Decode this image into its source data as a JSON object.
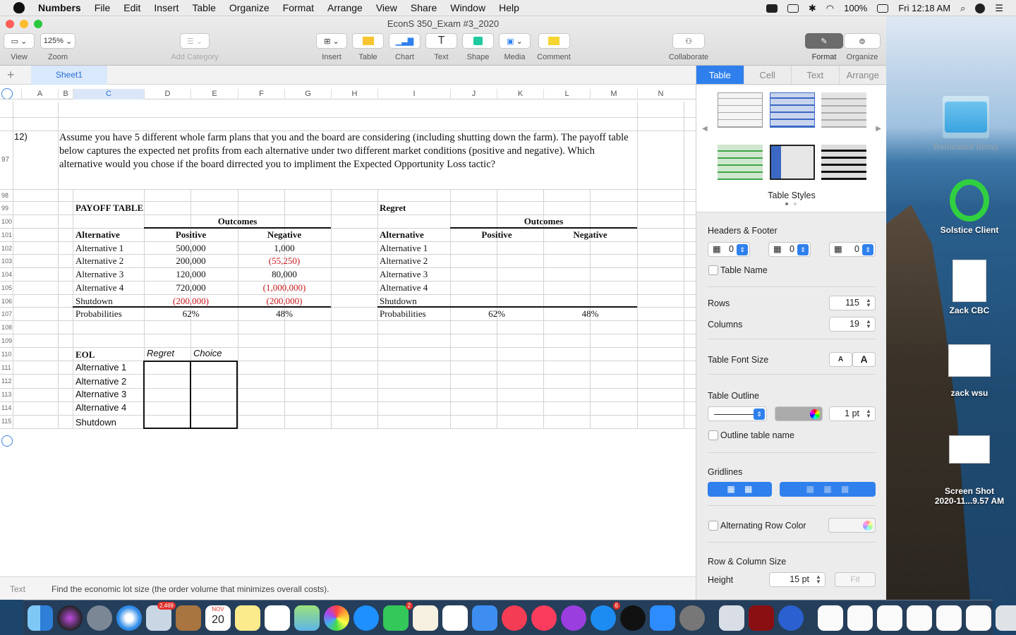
{
  "menubar": {
    "app": "Numbers",
    "items": [
      "File",
      "Edit",
      "Insert",
      "Table",
      "Organize",
      "Format",
      "Arrange",
      "View",
      "Share",
      "Window",
      "Help"
    ],
    "battery": "100%",
    "clock": "Fri 12:18 AM"
  },
  "window": {
    "title": "EconS 350_Exam #3_2020",
    "toolbar": {
      "view": "View",
      "zoom_value": "125%",
      "zoom": "Zoom",
      "add_category": "Add Category",
      "insert": "Insert",
      "table": "Table",
      "chart": "Chart",
      "text": "Text",
      "shape": "Shape",
      "media": "Media",
      "comment": "Comment",
      "collaborate": "Collaborate",
      "format": "Format",
      "organize": "Organize"
    },
    "sheet_tab": "Sheet1"
  },
  "columns": [
    "A",
    "B",
    "C",
    "D",
    "E",
    "F",
    "G",
    "H",
    "I",
    "J",
    "K",
    "L",
    "M",
    "N"
  ],
  "rows": [
    "97",
    "98",
    "99",
    "100",
    "101",
    "102",
    "103",
    "104",
    "105",
    "106",
    "107",
    "108",
    "109",
    "110",
    "111",
    "112",
    "113",
    "114",
    "115"
  ],
  "question": {
    "number": "12)",
    "text": "Assume you have 5 different whole farm plans that you and the board are considering (including shutting down the farm). The payoff table below captures the expected net profits from each alternative under two different market conditions (positive and negative). Which alternative would you chose if the board dirrected you to impliment the Expected Opportunity Loss tactic?"
  },
  "payoff": {
    "title": "PAYOFF TABLE",
    "outcomes": "Outcomes",
    "h_alt": "Alternative",
    "h_pos": "Positive",
    "h_neg": "Negative",
    "rows": [
      {
        "alt": "Alternative 1",
        "pos": "500,000",
        "neg": "1,000"
      },
      {
        "alt": "Alternative 2",
        "pos": "200,000",
        "neg": "(55,250)"
      },
      {
        "alt": "Alternative 3",
        "pos": "120,000",
        "neg": "80,000"
      },
      {
        "alt": "Alternative 4",
        "pos": "720,000",
        "neg": "(1,000,000)"
      },
      {
        "alt": "Shutdown",
        "pos": "(200,000)",
        "neg": "(200,000)"
      }
    ],
    "prob_label": "Probabilities",
    "prob_pos": "62%",
    "prob_neg": "48%"
  },
  "regret": {
    "title": "Regret",
    "outcomes": "Outcomes",
    "h_alt": "Alternative",
    "h_pos": "Positive",
    "h_neg": "Negative",
    "alts": [
      "Alternative 1",
      "Alternative 2",
      "Alternative 3",
      "Alternative 4",
      "Shutdown"
    ],
    "prob_label": "Probabilities",
    "prob_pos": "62%",
    "prob_neg": "48%"
  },
  "eol": {
    "title": "EOL",
    "h_regret": "Regret",
    "h_choice": "Choice",
    "alts": [
      "Alternative 1",
      "Alternative 2",
      "Alternative 3",
      "Alternative 4",
      "Shutdown"
    ]
  },
  "bottombar": {
    "label": "Text",
    "content": "Find the economic lot size (the order volume that minimizes overall costs)."
  },
  "sidebar": {
    "tabs": [
      "Table",
      "Cell",
      "Text",
      "Arrange"
    ],
    "table_styles": "Table Styles",
    "headers_footer": "Headers & Footer",
    "header_rows": "0",
    "header_cols": "0",
    "footer_rows": "0",
    "table_name": "Table Name",
    "rows_label": "Rows",
    "rows_value": "115",
    "columns_label": "Columns",
    "columns_value": "19",
    "font_size_label": "Table Font Size",
    "font_small": "A",
    "font_large": "A",
    "outline_label": "Table Outline",
    "outline_width": "1 pt",
    "outline_table_name": "Outline table name",
    "gridlines": "Gridlines",
    "alt_row_color": "Alternating Row Color",
    "row_col_size": "Row & Column Size",
    "height_label": "Height",
    "height_value": "15 pt",
    "fit": "Fit"
  },
  "desktop": {
    "icons": [
      "Relocated Items",
      "Solstice Client",
      "Zack CBC",
      "zack wsu",
      "Screen Shot\n2020-11...9.57 AM"
    ]
  },
  "dock": {
    "badges": {
      "mail": "2,469",
      "calendar_month": "NOV",
      "calendar_day": "20",
      "messages": "2",
      "appstore": "6"
    }
  },
  "colors": {
    "accent": "#2f80ed",
    "negative": "#c4171b"
  }
}
